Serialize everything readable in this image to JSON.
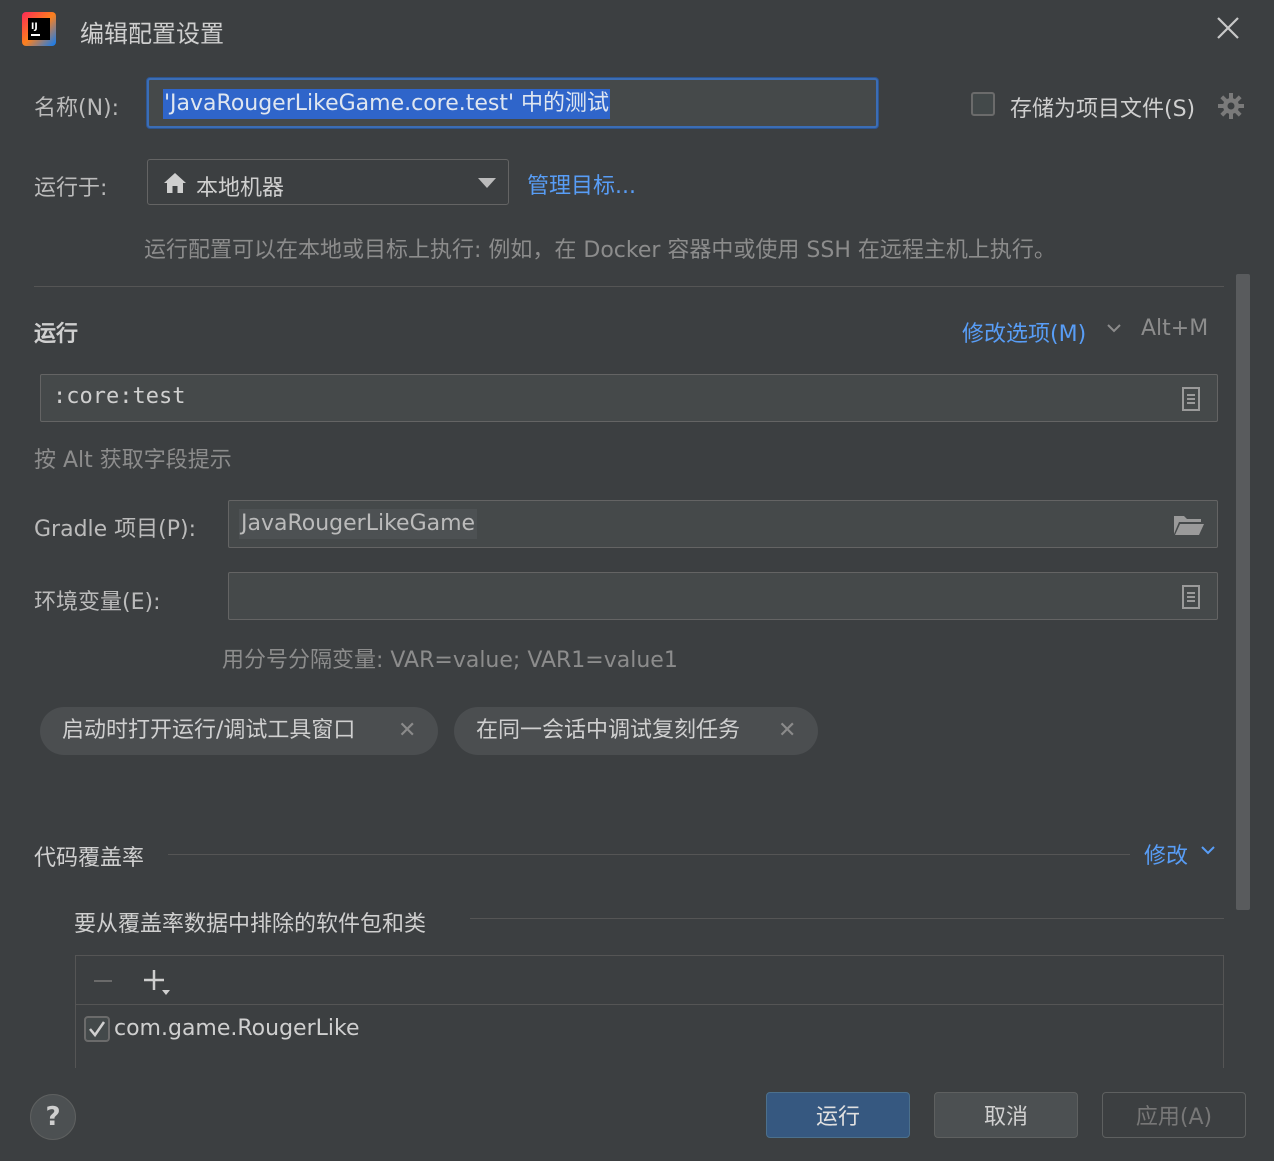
{
  "window": {
    "title": "编辑配置设置"
  },
  "form": {
    "name_label": "名称(N):",
    "name_value": "'JavaRougerLikeGame.core.test' 中的测试",
    "store_label": "存储为项目文件(S)",
    "run_on_label": "运行于:",
    "run_on_value": "本地机器",
    "manage_targets": "管理目标...",
    "run_on_hint": "运行配置可以在本地或目标上执行: 例如，在 Docker 容器中或使用 SSH 在远程主机上执行。"
  },
  "run_section": {
    "title": "运行",
    "modify_options": "修改选项(M)",
    "shortcut": "Alt+M",
    "tasks_value": ":core:test",
    "alt_hint": "按 Alt 获取字段提示",
    "gradle_label": "Gradle 项目(P):",
    "gradle_value": "JavaRougerLikeGame",
    "env_label": "环境变量(E):",
    "env_value": "",
    "env_hint": "用分号分隔变量: VAR=value; VAR1=value1",
    "chips": [
      {
        "label": "启动时打开运行/调试工具窗口"
      },
      {
        "label": "在同一会话中调试复刻任务"
      }
    ]
  },
  "coverage": {
    "title": "代码覆盖率",
    "modify": "修改",
    "exclude_title": "要从覆盖率数据中排除的软件包和类",
    "items": [
      {
        "label": "com.game.RougerLike",
        "checked": true
      }
    ]
  },
  "buttons": {
    "run": "运行",
    "cancel": "取消",
    "apply": "应用(A)",
    "help": "?"
  },
  "colors": {
    "background": "#3c3f41",
    "accent_link": "#589df6",
    "selection": "#2f65ca",
    "primary_button": "#365880"
  }
}
